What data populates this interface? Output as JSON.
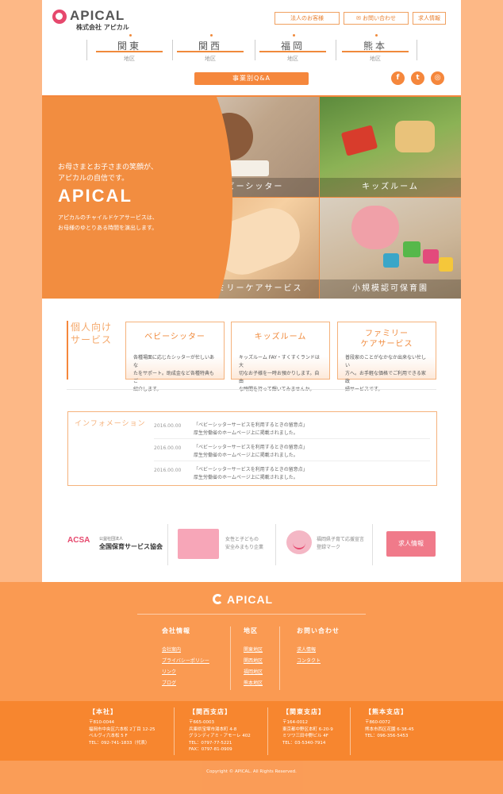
{
  "header": {
    "logo_text": "APICAL",
    "logo_sub": "株式会社 アピカル",
    "top_buttons": [
      "法人のお客様",
      "お問い合わせ",
      "求人情報"
    ],
    "regions": [
      {
        "name": "関東",
        "sub": "地区"
      },
      {
        "name": "関西",
        "sub": "地区"
      },
      {
        "name": "福岡",
        "sub": "地区"
      },
      {
        "name": "熊本",
        "sub": "地区"
      }
    ],
    "qa_label": "事業別Q&A",
    "sns": [
      "f",
      "t",
      "◎"
    ]
  },
  "hero": {
    "copy_line1": "お母さまとお子さまの笑顔が、",
    "copy_line2": "アピカルの自信です。",
    "logo": "APICAL",
    "small_line1": "アピカルのチャイルドケアサービスは、",
    "small_line2": "お母様のゆとりある時間を演出します。",
    "tiles": [
      "ベビーシッター",
      "キッズルーム",
      "ファミリーケアサービス",
      "小規模認可保育園"
    ]
  },
  "services": {
    "title_line1": "個人向け",
    "title_line2": "サービス",
    "cards": [
      {
        "name1": "ベビーシッター",
        "name2": "",
        "d1": "各種場面に応じたシッターが忙しいあな",
        "d2": "たをサポート。助成金など各種特典もご",
        "d3": "紹介します。"
      },
      {
        "name1": "キッズルーム",
        "name2": "",
        "d1": "キッズルーム FAY・すくすくランドは大",
        "d2": "切なお子様を一時お預かりします。自由",
        "d3": "な時間を持って輝いてみませんか。"
      },
      {
        "name1": "ファミリー",
        "name2": "ケアサービス",
        "d1": "普段家のことがなかなか出来ない忙しい",
        "d2": "方へ。お手軽な価格でご利用できる家政",
        "d3": "婦サービスです。"
      }
    ]
  },
  "info": {
    "title": "インフォメーション",
    "items": [
      {
        "date": "2016.00.00",
        "line1": "「ベビーシッターサービスを利用するときの留意点」",
        "line2": "厚生労働省のホームページ上に掲載されました。"
      },
      {
        "date": "2016.00.00",
        "line1": "「ベビーシッターサービスを利用するときの留意点」",
        "line2": "厚生労働省のホームページ上に掲載されました。"
      },
      {
        "date": "2016.00.00",
        "line1": "「ベビーシッターサービスを利用するときの留意点」",
        "line2": "厚生労働省のホームページ上に掲載されました。"
      }
    ]
  },
  "banners": {
    "acsa": "ACSA",
    "acsa_small": "公益社団法人",
    "acsa_name": "全国保育サービス協会",
    "women_line1": "女性と子どもの",
    "women_line2": "安全みまもり企業",
    "fukuoka_line1": "福岡県子育て応援宣言",
    "fukuoka_line2": "登録マーク",
    "recruit": "求人情報"
  },
  "footer": {
    "logo": "APICAL",
    "cols": [
      {
        "title": "会社情報",
        "links": [
          "会社案内",
          "プライバシーポリシー",
          "リンク",
          "ブログ"
        ]
      },
      {
        "title": "地区",
        "links": [
          "関東地区",
          "関西地区",
          "福岡地区",
          "熊本地区"
        ]
      },
      {
        "title": "お問い合わせ",
        "links": [
          "求人情報",
          "コンタクト"
        ]
      }
    ],
    "branches": [
      {
        "name": "【本社】",
        "lines": [
          "〒810-0044",
          "福岡市中央区六本松 2丁目 12-25",
          "ベルヴィ六本松 5 F",
          "TEL：092-741-1833（代表）"
        ]
      },
      {
        "name": "【関西支店】",
        "lines": [
          "〒665-0003",
          "兵庫県宝塚市湯本町 4-8",
          "グランディアミ・アモーレ 402",
          "TEL：0797-77-5221",
          "FAX：0797-81-0909"
        ]
      },
      {
        "name": "【関東支店】",
        "lines": [
          "〒164-0012",
          "東京都中野区本町 6-20-9",
          "ミツワ三田中野ビル 4F",
          "TEL：03-5340-7914"
        ]
      },
      {
        "name": "【熊本支店】",
        "lines": [
          "〒860-0072",
          "熊本市西区花園 6-38-45",
          "TEL：096-356-5453"
        ]
      }
    ],
    "copyright": "Copyright © APICAL. All Rights Reserved."
  },
  "colors": {
    "accent": "#f5873c",
    "background": "#fdb886",
    "pink": "#e6486d"
  }
}
